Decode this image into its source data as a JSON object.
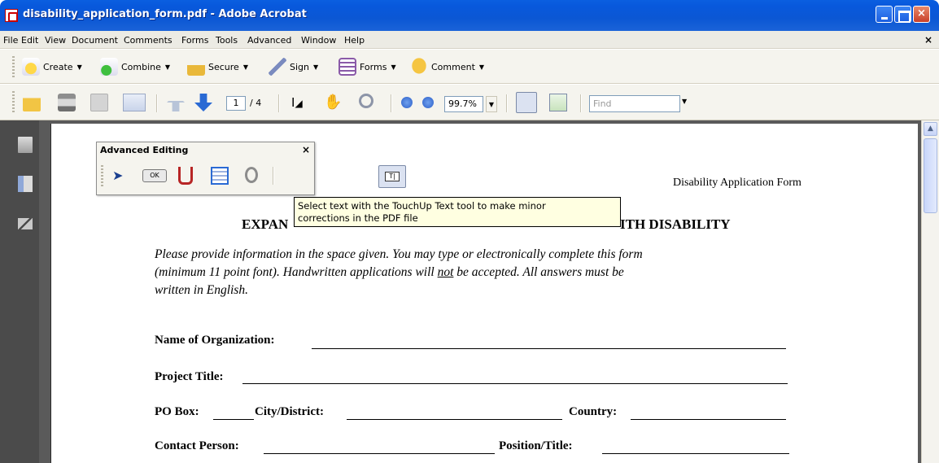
{
  "window": {
    "title": "disability_application_form.pdf - Adobe Acrobat",
    "close_glyph": "×"
  },
  "menubar": {
    "items": [
      "File",
      "Edit",
      "View",
      "Document",
      "Comments",
      "Forms",
      "Tools",
      "Advanced",
      "Window",
      "Help"
    ],
    "close_glyph": "×"
  },
  "task_toolbar": {
    "create": "Create",
    "combine": "Combine",
    "secure": "Secure",
    "sign": "Sign",
    "forms": "Forms",
    "comment": "Comment",
    "caret": "▼"
  },
  "std_toolbar": {
    "page_current": "1",
    "page_total": "/ 4",
    "zoom": "99.7%",
    "find_placeholder": "Find",
    "caret": "▼"
  },
  "palette": {
    "title": "Advanced Editing",
    "close_glyph": "×",
    "ok_label": "OK"
  },
  "tooltip": {
    "line1": "Select text with the TouchUp Text tool to make minor",
    "line2": "corrections in the PDF file"
  },
  "document": {
    "header_right": "Disability Application Form",
    "title_left_visible": "EXPAN",
    "title_right_visible": "ITH DISABILITY",
    "instructions_line1": "Please provide information in the space given. You may type or electronically complete this form",
    "instructions_line2_a": "(minimum 11 point font).   Handwritten applications will ",
    "instructions_line2_not": "not",
    "instructions_line2_b": " be accepted.   All answers must be",
    "instructions_line3": "written in English.",
    "fields": {
      "org": "Name of Organization:",
      "project": "Project Title:",
      "po_box": "PO Box:",
      "city": "City/District:",
      "country": "Country:",
      "contact": "Contact Person:",
      "position": "Position/Title:"
    }
  },
  "colors": {
    "title_bar": "#0858dc",
    "nav_pane": "#4b4b4b",
    "doc_background": "#5a5a5a",
    "tooltip_bg": "#ffffe1"
  }
}
